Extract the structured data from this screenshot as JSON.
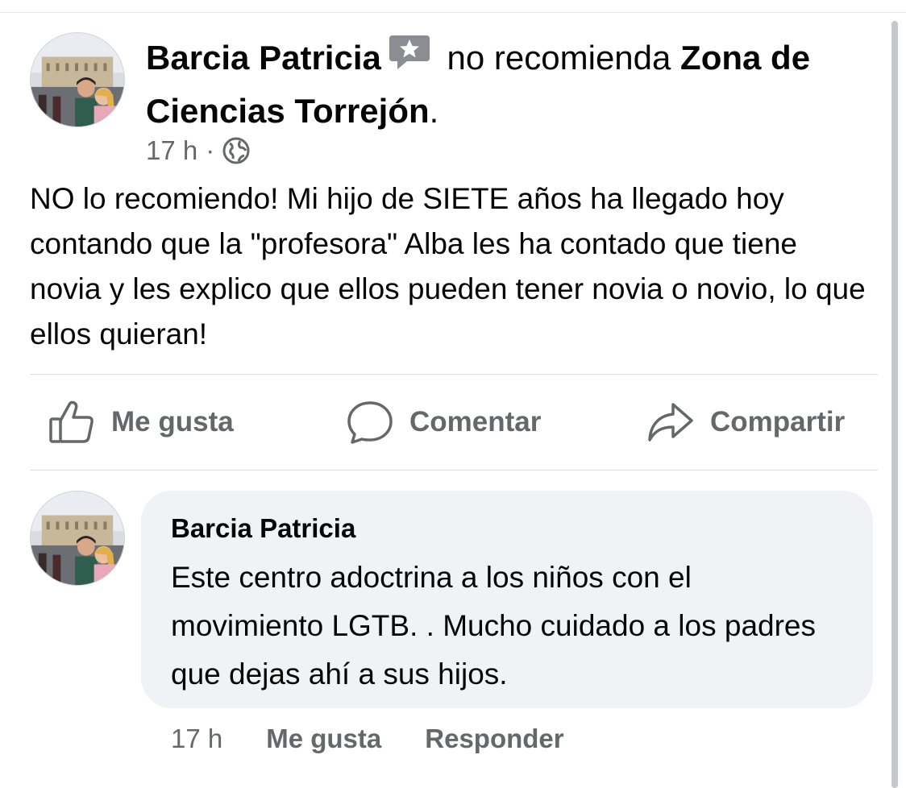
{
  "post": {
    "author": "Barcia Patricia",
    "verb": "no recomienda",
    "page": "Zona de Ciencias Torrejón",
    "page_suffix": ".",
    "time": "17 h",
    "separator": "·",
    "privacy_icon": "globe-icon",
    "badge_icon": "star-review-icon",
    "text": "NO lo recomiendo! Mi hijo de SIETE años ha llegado hoy contando que la \"profesora\" Alba les ha contado que tiene novia y les explico que ellos pueden tener novia o novio, lo que ellos quieran!"
  },
  "actions": {
    "like": "Me gusta",
    "comment": "Comentar",
    "share": "Compartir"
  },
  "comment": {
    "author": "Barcia Patricia",
    "text": "Este centro adoctrina a los niños con el movimiento LGTB. . Mucho cuidado a los padres que dejas ahí a sus hijos.",
    "time": "17 h",
    "like": "Me gusta",
    "reply": "Responder"
  },
  "colors": {
    "text": "#050505",
    "secondary": "#65676b",
    "bubble": "#f0f2f5",
    "divider": "#dadde1"
  }
}
